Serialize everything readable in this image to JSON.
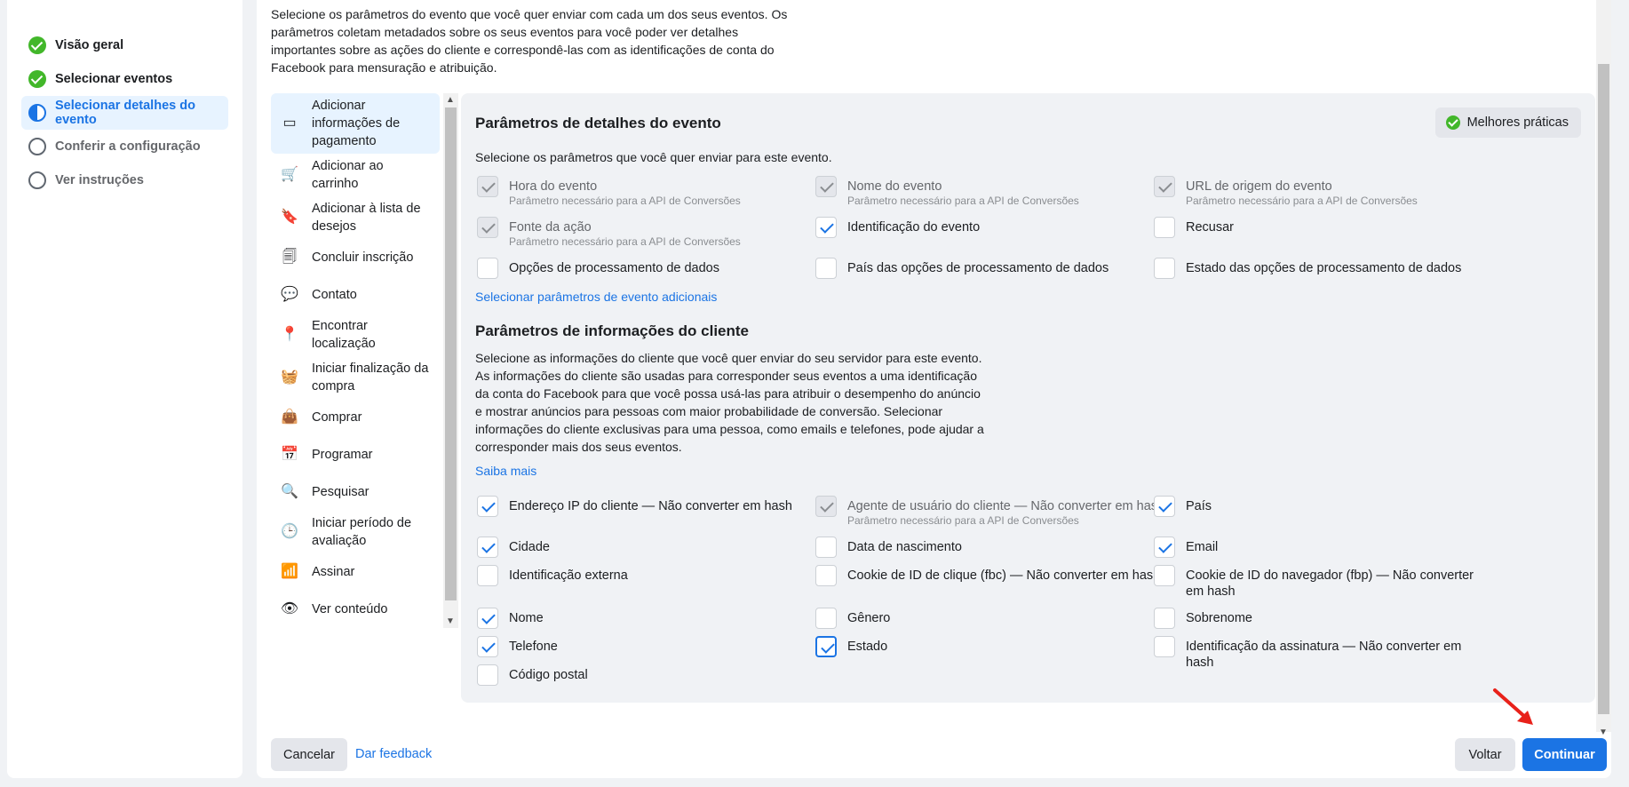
{
  "stepper": {
    "steps": [
      {
        "label": "Visão geral",
        "state": "done"
      },
      {
        "label": "Selecionar eventos",
        "state": "done"
      },
      {
        "label": "Selecionar detalhes do evento",
        "state": "active"
      },
      {
        "label": "Conferir a configuração",
        "state": "todo"
      },
      {
        "label": "Ver instruções",
        "state": "todo"
      }
    ]
  },
  "intro": "Selecione os parâmetros do evento que você quer enviar com cada um dos seus eventos. Os parâmetros coletam metadados sobre os seus eventos para você poder ver detalhes importantes sobre as ações do cliente e correspondê-las com as identificações de conta do Facebook para mensuração e atribuição.",
  "events": [
    {
      "label": "Adicionar informações de pagamento",
      "icon": "credit-card-icon",
      "glyph": "▭"
    },
    {
      "label": "Adicionar ao carrinho",
      "icon": "cart-icon",
      "glyph": "🛒"
    },
    {
      "label": "Adicionar à lista de desejos",
      "icon": "bookmark-icon",
      "glyph": "🔖"
    },
    {
      "label": "Concluir inscrição",
      "icon": "registration-icon",
      "glyph": "🗐"
    },
    {
      "label": "Contato",
      "icon": "chat-bubble-icon",
      "glyph": "💬"
    },
    {
      "label": "Encontrar localização",
      "icon": "location-pin-icon",
      "glyph": "📍"
    },
    {
      "label": "Iniciar finalização da compra",
      "icon": "basket-icon",
      "glyph": "🧺"
    },
    {
      "label": "Comprar",
      "icon": "shopping-bag-icon",
      "glyph": "👜"
    },
    {
      "label": "Programar",
      "icon": "calendar-icon",
      "glyph": "📅"
    },
    {
      "label": "Pesquisar",
      "icon": "search-icon",
      "glyph": "🔍"
    },
    {
      "label": "Iniciar período de avaliação",
      "icon": "clock-icon",
      "glyph": "🕒"
    },
    {
      "label": "Assinar",
      "icon": "rss-icon",
      "glyph": "📶"
    },
    {
      "label": "Ver conteúdo",
      "icon": "eye-icon",
      "glyph": "👁"
    }
  ],
  "card": {
    "best_practices": "Melhores práticas",
    "event_params_title": "Parâmetros de detalhes do evento",
    "event_params_sub": "Selecione os parâmetros que você quer enviar para este evento.",
    "event_params": [
      {
        "label": "Hora do evento",
        "hint": "Parâmetro necessário para a API de Conversões",
        "state": "disabled"
      },
      {
        "label": "Nome do evento",
        "hint": "Parâmetro necessário para a API de Conversões",
        "state": "disabled"
      },
      {
        "label": "URL de origem do evento",
        "hint": "Parâmetro necessário para a API de Conversões",
        "state": "disabled"
      },
      {
        "label": "Fonte da ação",
        "hint": "Parâmetro necessário para a API de Conversões",
        "state": "disabled"
      },
      {
        "label": "Identificação do evento",
        "hint": "",
        "state": "checked"
      },
      {
        "label": "Recusar",
        "hint": "",
        "state": "unchecked"
      },
      {
        "label": "Opções de processamento de dados",
        "hint": "",
        "state": "unchecked"
      },
      {
        "label": "País das opções de processamento de dados",
        "hint": "",
        "state": "unchecked"
      },
      {
        "label": "Estado das opções de processamento de dados",
        "hint": "",
        "state": "unchecked"
      }
    ],
    "more_event_params_link": "Selecionar parâmetros de evento adicionais",
    "customer_title": "Parâmetros de informações do cliente",
    "customer_sub": "Selecione as informações do cliente que você quer enviar do seu servidor para este evento. As informações do cliente são usadas para corresponder seus eventos a uma identificação da conta do Facebook para que você possa usá-las para atribuir o desempenho do anúncio e mostrar anúncios para pessoas com maior probabilidade de conversão. Selecionar informações do cliente exclusivas para uma pessoa, como emails e telefones, pode ajudar a corresponder mais dos seus eventos.",
    "learn_more": "Saiba mais",
    "customer_params": [
      {
        "label": "Endereço IP do cliente — Não converter em hash",
        "hint": "",
        "state": "checked"
      },
      {
        "label": "Agente de usuário do cliente — Não converter em hash",
        "hint": "Parâmetro necessário para a API de Conversões",
        "state": "disabled"
      },
      {
        "label": "País",
        "hint": "",
        "state": "checked"
      },
      {
        "label": "Cidade",
        "hint": "",
        "state": "checked"
      },
      {
        "label": "Data de nascimento",
        "hint": "",
        "state": "unchecked"
      },
      {
        "label": "Email",
        "hint": "",
        "state": "checked"
      },
      {
        "label": "Identificação externa",
        "hint": "",
        "state": "unchecked"
      },
      {
        "label": "Cookie de ID de clique (fbc) — Não converter em hash",
        "hint": "",
        "state": "unchecked"
      },
      {
        "label": "Cookie de ID do navegador (fbp) — Não converter em hash",
        "hint": "",
        "state": "unchecked"
      },
      {
        "label": "Nome",
        "hint": "",
        "state": "checked"
      },
      {
        "label": "Gênero",
        "hint": "",
        "state": "unchecked"
      },
      {
        "label": "Sobrenome",
        "hint": "",
        "state": "unchecked"
      },
      {
        "label": "Telefone",
        "hint": "",
        "state": "checked"
      },
      {
        "label": "Estado",
        "hint": "",
        "state": "focused"
      },
      {
        "label": "Identificação da assinatura — Não converter em hash",
        "hint": "",
        "state": "unchecked"
      },
      {
        "label": "Código postal",
        "hint": "",
        "state": "unchecked"
      }
    ]
  },
  "footer": {
    "cancel": "Cancelar",
    "feedback": "Dar feedback",
    "back": "Voltar",
    "continue": "Continuar"
  },
  "colors": {
    "accent": "#1b74e4",
    "success": "#42b72a",
    "annotation_arrow": "#e8211a"
  }
}
